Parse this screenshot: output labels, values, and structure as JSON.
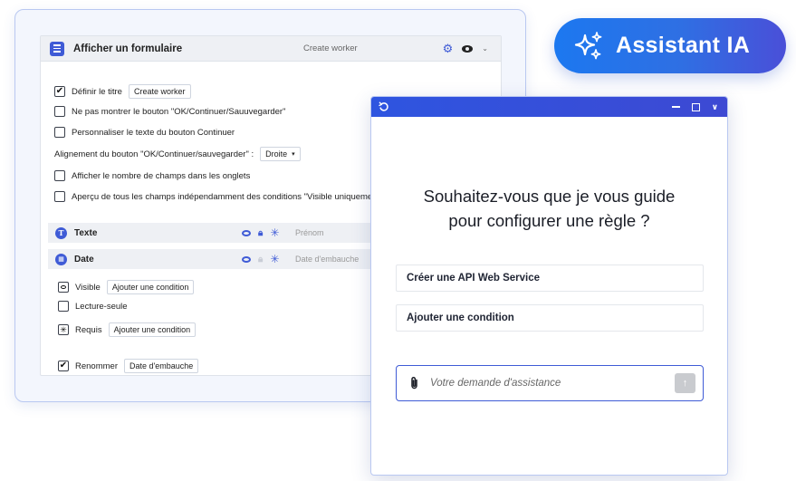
{
  "form": {
    "title": "Afficher un formulaire",
    "subtitle": "Create worker",
    "options": [
      {
        "label": "Définir le titre",
        "checked": true,
        "chip": "Create worker"
      },
      {
        "label": "Ne pas montrer le bouton \"OK/Continuer/Sauuvegarder\"",
        "checked": false
      },
      {
        "label": "Personnaliser le texte du bouton Continuer",
        "checked": false
      },
      {
        "label": "Afficher le nombre de champs dans les onglets",
        "checked": false
      },
      {
        "label": "Aperçu de tous les champs indépendamment des conditions \"Visible uniqueme",
        "checked": false
      }
    ],
    "alignment": {
      "label": "Alignement du bouton \"OK/Continuer/sauvegarder\" :",
      "value": "Droite"
    },
    "fields": [
      {
        "icon": "T",
        "name": "Texte",
        "placeholder": "Prénom",
        "locked": true
      },
      {
        "icon": "calendar",
        "name": "Date",
        "placeholder": "Date d'embauche",
        "locked": false
      }
    ],
    "field_options": [
      {
        "label": "Visible",
        "chip": "Ajouter une condition",
        "state": "eye"
      },
      {
        "label": "Lecture-seule",
        "state": "unchecked"
      },
      {
        "label": "Requis",
        "chip": "Ajouter une condition",
        "state": "asterisk"
      },
      {
        "label": "Renommer",
        "chip": "Date d'embauche",
        "state": "checked"
      }
    ]
  },
  "assistant_badge": {
    "label": "Assistant IA"
  },
  "chat": {
    "question_line1": "Souhaitez-vous que je vous guide",
    "question_line2": "pour configurer une règle ?",
    "suggestions": [
      "Créer une API Web Service",
      "Ajouter une condition"
    ],
    "input_placeholder": "Votre demande d'assistance"
  },
  "colors": {
    "accent": "#3f5bd6",
    "badge_start": "#1c78f0",
    "badge_end": "#4a4fd8",
    "titlebar": "#2e55e0"
  }
}
